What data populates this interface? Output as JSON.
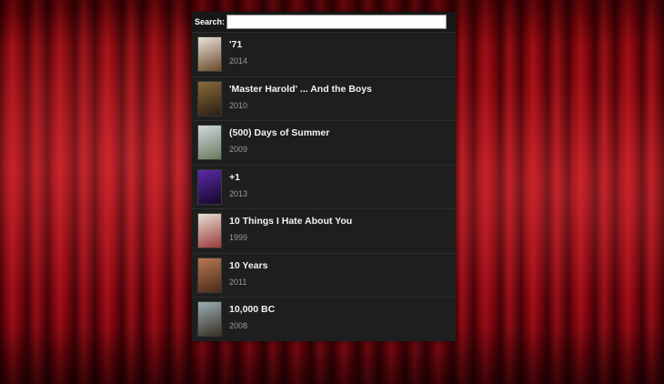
{
  "search": {
    "label": "Search:",
    "value": "",
    "placeholder": ""
  },
  "movies": [
    {
      "title": "'71",
      "year": "2014",
      "poster_colors": [
        "#e8e2d8",
        "#6b4a2a"
      ]
    },
    {
      "title": "'Master Harold' ... And the Boys",
      "year": "2010",
      "poster_colors": [
        "#8a6a3a",
        "#2a1e12"
      ]
    },
    {
      "title": "(500) Days of Summer",
      "year": "2009",
      "poster_colors": [
        "#cfd8e0",
        "#6a7a5a"
      ]
    },
    {
      "title": "+1",
      "year": "2013",
      "poster_colors": [
        "#5a2aa8",
        "#14082a"
      ]
    },
    {
      "title": "10 Things I Hate About You",
      "year": "1999",
      "poster_colors": [
        "#e8e0d4",
        "#9a3a3a"
      ]
    },
    {
      "title": "10 Years",
      "year": "2011",
      "poster_colors": [
        "#b87850",
        "#4a2a1a"
      ]
    },
    {
      "title": "10,000 BC",
      "year": "2008",
      "poster_colors": [
        "#9ab0b8",
        "#3a3020"
      ]
    }
  ],
  "colors": {
    "panel_bg": "#1e1e1e",
    "curtain": "#b0101a"
  }
}
